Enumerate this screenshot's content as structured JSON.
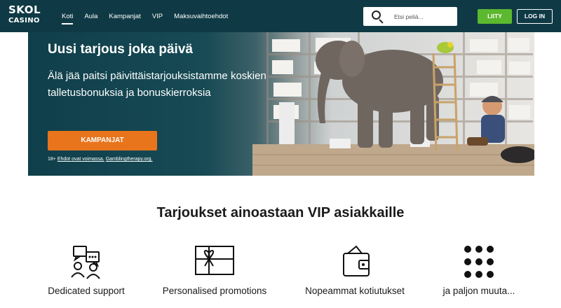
{
  "header": {
    "logo_line1": "SKOL",
    "logo_line2": "CASINO",
    "nav": [
      {
        "label": "Koti",
        "active": true
      },
      {
        "label": "Aula",
        "active": false
      },
      {
        "label": "Kampanjat",
        "active": false
      },
      {
        "label": "VIP",
        "active": false
      },
      {
        "label": "Maksuvaihtoehdot",
        "active": false
      }
    ],
    "search_placeholder": "Etsi peliä...",
    "join_label": "LIITY",
    "login_label": "LOG IN"
  },
  "hero": {
    "title": "Uusi tarjous joka päivä",
    "subtitle": "Älä jää paitsi päivittäistarjouksistamme koskien talletusbonuksia ja bonuskierroksia",
    "cta_label": "KAMPANJAT",
    "terms_age": "18+",
    "terms_link1": "Ehdot ovat voimassa.",
    "terms_link2": "Gamblingtherapy.org."
  },
  "vip": {
    "title": "Tarjoukset ainoastaan VIP asiakkaille",
    "features": [
      {
        "label": "Dedicated support",
        "icon": "support-chat-icon"
      },
      {
        "label": "Personalised promotions",
        "icon": "gift-card-icon"
      },
      {
        "label": "Nopeammat kotiutukset",
        "icon": "wallet-icon"
      },
      {
        "label": "ja paljon muuta...",
        "icon": "dots-grid-icon"
      }
    ]
  },
  "colors": {
    "header_bg": "#0f3a45",
    "join_button": "#5cb82e",
    "cta_button": "#e8741c"
  }
}
